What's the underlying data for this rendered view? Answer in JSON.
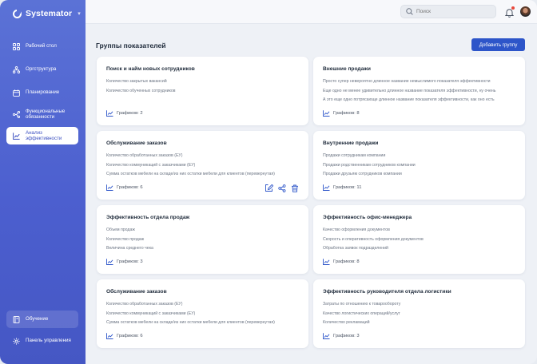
{
  "app": {
    "name": "Systemator"
  },
  "sidebar": {
    "items": [
      {
        "label": "Рабочий стол",
        "icon": "grid-icon"
      },
      {
        "label": "Оргструктура",
        "icon": "org-structure-icon"
      },
      {
        "label": "Планирование",
        "icon": "calendar-icon"
      },
      {
        "label": "Функциональные обязанности",
        "icon": "workflow-icon"
      },
      {
        "label": "Анализ эффективности",
        "icon": "chart-icon",
        "active": true
      }
    ],
    "bottom": [
      {
        "label": "Обучение",
        "icon": "book-icon"
      },
      {
        "label": "Панель управления",
        "icon": "gear-icon"
      }
    ]
  },
  "header": {
    "search_placeholder": "Поиск"
  },
  "main": {
    "title": "Группы показателей",
    "add_button": "Добавить группу",
    "cards": [
      {
        "title": "Поиск и найм новых сотрудников",
        "metrics": [
          "Количество закрытых вакансий",
          "Количество обученных сотрудников"
        ],
        "charts": "Графиков: 2"
      },
      {
        "title": "Внешние продажи",
        "metrics": [
          "Просто супер невероятно длинное название немыслимого показателя эффективности",
          "Еще одно не менее удивительно длинное название показателя эффективности, ну очень",
          "А это еще одно потрясающе длинное название показателя эффективности, как оно есть"
        ],
        "charts": "Графиков: 8"
      },
      {
        "title": "Обслуживание заказов",
        "metrics": [
          "Количество обработанных заказов (ЕУ)",
          "Количество коммуникаций с заказчиками (ЕУ)",
          "Сумма остатков мебели на складе/из них остатки мебели для клиентов (перевернутая)"
        ],
        "charts": "Графиков: 6",
        "actions": true
      },
      {
        "title": "Внутренние продажи",
        "metrics": [
          "Продажи сотрудникам компании",
          "Продажи родственникам сотрудников компании",
          "Продажи друзьям сотрудников компании"
        ],
        "charts": "Графиков: 11"
      },
      {
        "title": "Эффективность отдела продаж",
        "metrics": [
          "Объем продаж",
          "Количество продаж",
          "Величина среднего чека"
        ],
        "charts": "Графиков: 3"
      },
      {
        "title": "Эффективность офис-менеджера",
        "metrics": [
          "Качество оформления документов",
          "Скорость и оперативность оформления документов",
          "Обработка заявок подразделений"
        ],
        "charts": "Графиков: 8"
      },
      {
        "title": "Обслуживание заказов",
        "metrics": [
          "Количество обработанных заказов (ЕУ)",
          "Количество коммуникаций с заказчиками (ЕУ)",
          "Сумма остатков мебели на складе/из них остатки мебели для клиентов (перевернутая)"
        ],
        "charts": "Графиков: 6"
      },
      {
        "title": "Эффективность руководителя отдела логистики",
        "metrics": [
          "Затраты по отношению к товарообороту",
          "Качество логистических операций/услуг",
          "Количество рекламаций"
        ],
        "charts": "Графиков: 3"
      }
    ]
  },
  "colors": {
    "sidebar": "#5066d0",
    "accent": "#2d55c9",
    "notification": "#e8473b"
  }
}
